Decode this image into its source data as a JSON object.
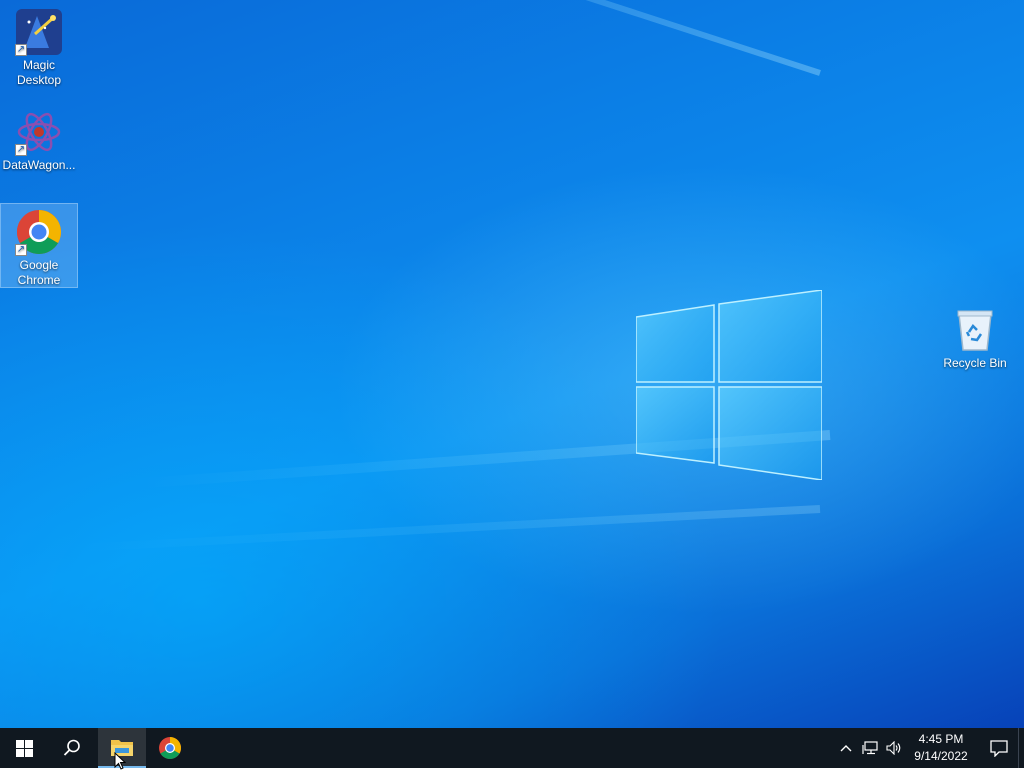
{
  "desktop": {
    "icons": [
      {
        "label": "Magic\nDesktop",
        "icon": "magic-wand-icon",
        "shortcut": true
      },
      {
        "label": "DataWagon...",
        "icon": "datawagon-atom-icon",
        "shortcut": true
      },
      {
        "label": "Google\nChrome",
        "icon": "chrome-icon",
        "shortcut": true,
        "selected": true
      },
      {
        "label": "Recycle Bin",
        "icon": "recycle-bin-icon",
        "shortcut": false
      }
    ],
    "colors": {
      "wallpaper_light": "#0e8ff0",
      "wallpaper_dark": "#0742b8",
      "logo_glow": "#bdf0ff"
    }
  },
  "taskbar": {
    "start_icon": "windows-logo-icon",
    "search_icon": "search-icon",
    "pinned": [
      {
        "name": "file-explorer",
        "icon": "folder-icon",
        "active": true
      },
      {
        "name": "google-chrome",
        "icon": "chrome-icon",
        "active": false
      }
    ],
    "tray": {
      "icons": [
        "chevron-up-icon",
        "network-icon",
        "volume-icon"
      ],
      "time": "4:45 PM",
      "date": "9/14/2022",
      "notification_icon": "action-center-icon"
    },
    "colors": {
      "background": "#101820",
      "accent": "#76b9ed"
    }
  }
}
